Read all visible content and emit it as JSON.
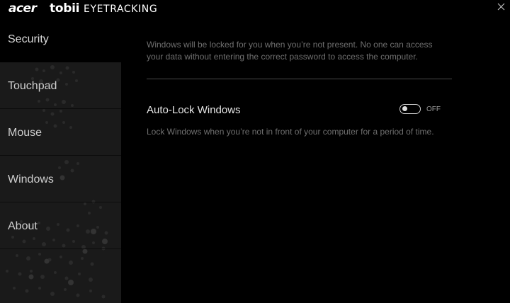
{
  "titlebar": {
    "brand_acer": "acer",
    "brand_tobii": "tobii",
    "brand_eyetracking": "EYETRACKING",
    "close_icon": "close-icon"
  },
  "sidebar": {
    "items": [
      {
        "label": "Security",
        "active": true
      },
      {
        "label": "Touchpad",
        "active": false
      },
      {
        "label": "Mouse",
        "active": false
      },
      {
        "label": "Windows",
        "active": false
      },
      {
        "label": "About",
        "active": false
      }
    ]
  },
  "main": {
    "description": "Windows will be locked for you when you’re not present. No one can access your data without entering the correct password to access the computer.",
    "setting": {
      "title": "Auto-Lock Windows",
      "toggle_state": "OFF",
      "description": "Lock Windows when you’re not in front of your computer for a period of time."
    }
  },
  "colors": {
    "background": "#000000",
    "sidebar": "#1a1a1a",
    "muted_text": "#6f6f6f"
  }
}
